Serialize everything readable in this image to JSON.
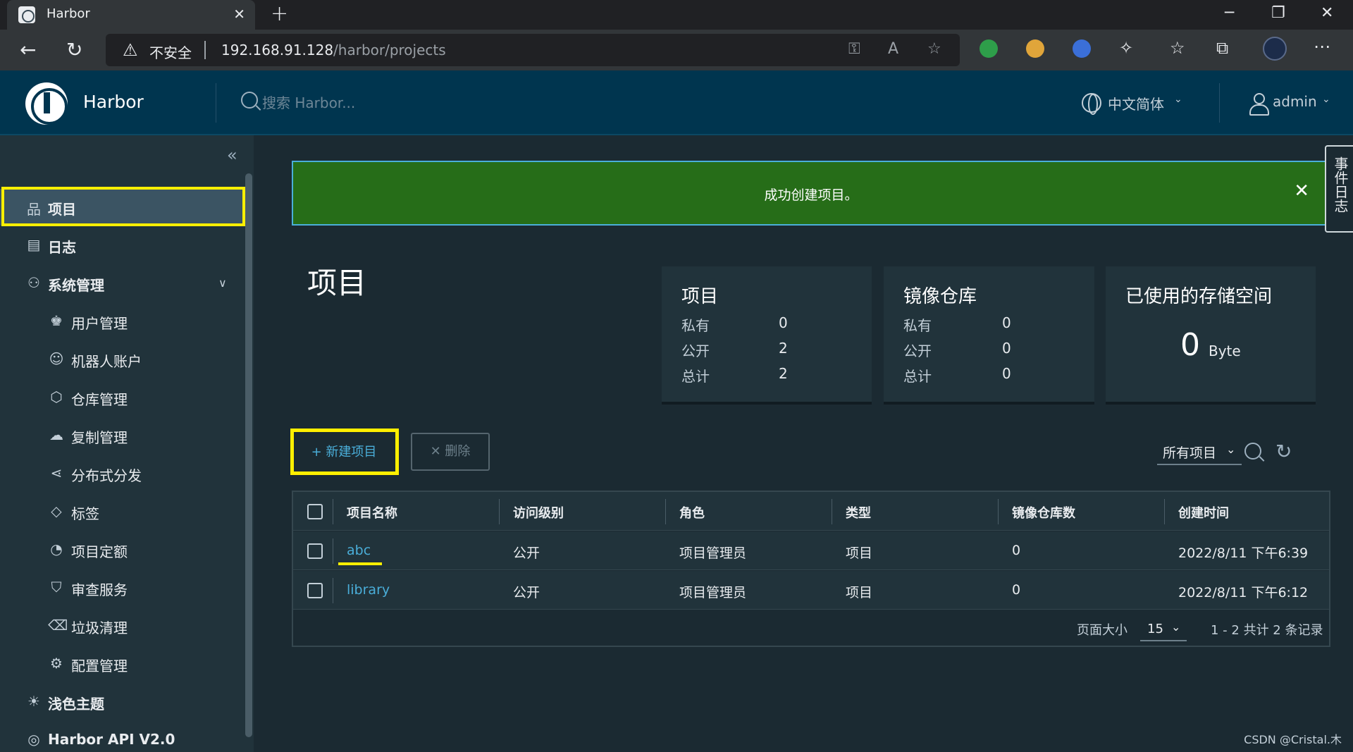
{
  "browser": {
    "tab_title": "Harbor",
    "tab_close": "✕",
    "new_tab": "+",
    "security_label": "不安全",
    "url_host": "192.168.91.128",
    "url_path": "/harbor/projects"
  },
  "header": {
    "brand": "Harbor",
    "search_placeholder": "搜索 Harbor...",
    "language": "中文简体",
    "user": "admin"
  },
  "sidebar": {
    "items": [
      {
        "label": "项目",
        "icon": "projects-icon"
      },
      {
        "label": "日志",
        "icon": "logs-icon"
      },
      {
        "label": "系统管理",
        "icon": "admin-icon"
      },
      {
        "label": "用户管理",
        "icon": "users-icon"
      },
      {
        "label": "机器人账户",
        "icon": "robot-icon"
      },
      {
        "label": "仓库管理",
        "icon": "registry-icon"
      },
      {
        "label": "复制管理",
        "icon": "replication-icon"
      },
      {
        "label": "分布式分发",
        "icon": "distribution-icon"
      },
      {
        "label": "标签",
        "icon": "tag-icon"
      },
      {
        "label": "项目定额",
        "icon": "quota-icon"
      },
      {
        "label": "审查服务",
        "icon": "shield-icon"
      },
      {
        "label": "垃圾清理",
        "icon": "trash-icon"
      },
      {
        "label": "配置管理",
        "icon": "gear-icon"
      },
      {
        "label": "浅色主题",
        "icon": "sun-icon"
      },
      {
        "label": "Harbor API V2.0",
        "icon": "api-icon"
      }
    ]
  },
  "alert": {
    "message": "成功创建项目。",
    "close": "✕"
  },
  "event_log_tab": "事件日志",
  "page": {
    "title": "项目"
  },
  "cards": {
    "projects": {
      "title": "项目",
      "private_label": "私有",
      "private": "0",
      "public_label": "公开",
      "public": "2",
      "total_label": "总计",
      "total": "2"
    },
    "repos": {
      "title": "镜像仓库",
      "private_label": "私有",
      "private": "0",
      "public_label": "公开",
      "public": "0",
      "total_label": "总计",
      "total": "0"
    },
    "storage": {
      "title": "已使用的存储空间",
      "value": "0",
      "unit": "Byte"
    }
  },
  "toolbar": {
    "new_project": "+ 新建项目",
    "delete": "✕ 删除",
    "filter": "所有项目"
  },
  "table": {
    "headers": [
      "项目名称",
      "访问级别",
      "角色",
      "类型",
      "镜像仓库数",
      "创建时间"
    ],
    "rows": [
      [
        "abc",
        "公开",
        "项目管理员",
        "项目",
        "0",
        "2022/8/11 下午6:39"
      ],
      [
        "library",
        "公开",
        "项目管理员",
        "项目",
        "0",
        "2022/8/11 下午6:12"
      ]
    ],
    "page_size_label": "页面大小",
    "page_size": "15",
    "page_info": "1 - 2 共计 2 条记录"
  },
  "watermark": "CSDN @Cristal.木",
  "colors": {
    "header": "#00354f",
    "sidebar": "#21333b",
    "content": "#1b2a32",
    "alert": "#266d18",
    "accent": "#4aaed9",
    "highlight": "#ffef00"
  }
}
